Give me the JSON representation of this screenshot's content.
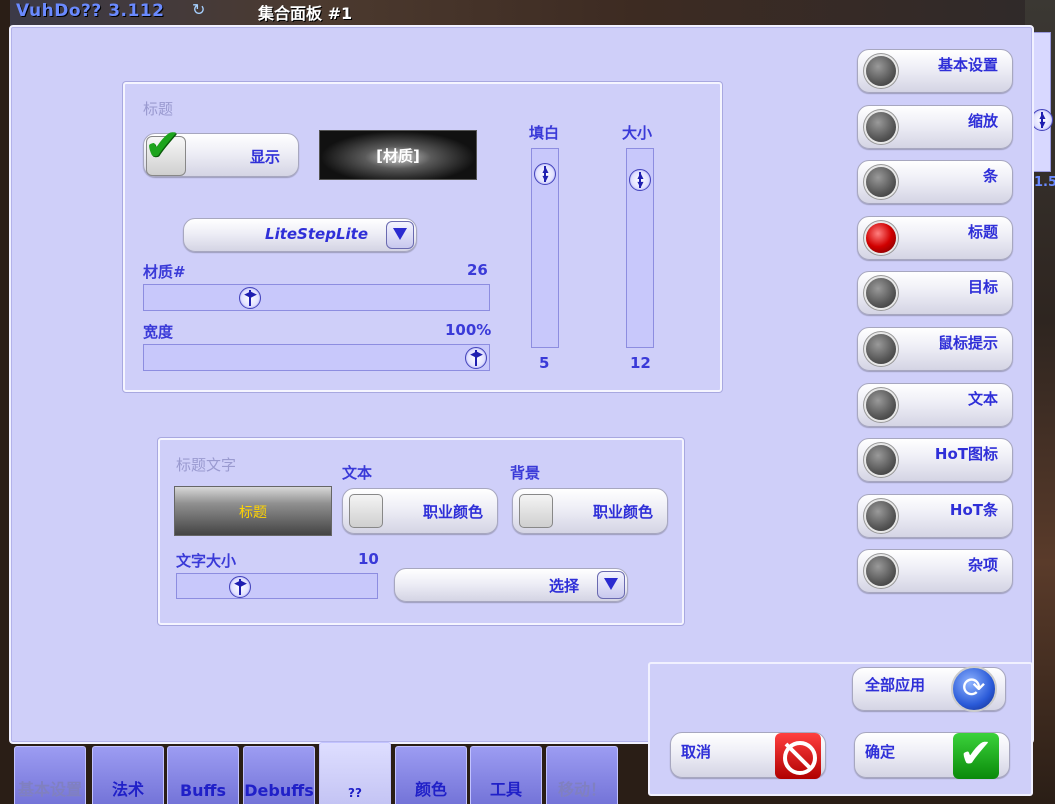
{
  "topbar": {
    "title": "VuhDo?? 3.112",
    "refresh_icon": "refresh-icon",
    "tab_label": "集合面板 #1"
  },
  "title_panel": {
    "heading": "标题",
    "show_label": "显示",
    "show_checked": true,
    "texture_label": "[材质]",
    "texture_select": "LiteStepLite",
    "texture_num_label": "材质#",
    "texture_num_value": "26",
    "width_label": "宽度",
    "width_value": "100%",
    "padding_label": "填白",
    "padding_value": "5",
    "size_label": "大小",
    "size_value": "12"
  },
  "title_text_panel": {
    "heading": "标题文字",
    "preview": "标题",
    "text_label": "文本",
    "text_color_button": "职业颜色",
    "bg_label": "背景",
    "bg_color_button": "职业颜色",
    "font_size_label": "文字大小",
    "font_size_value": "10",
    "select_button": "选择"
  },
  "side_menu": [
    {
      "label": "基本设置",
      "active": false
    },
    {
      "label": "缩放",
      "active": false
    },
    {
      "label": "条",
      "active": false
    },
    {
      "label": "标题",
      "active": true
    },
    {
      "label": "目标",
      "active": false
    },
    {
      "label": "鼠标提示",
      "active": false
    },
    {
      "label": "文本",
      "active": false
    },
    {
      "label": "HoT图标",
      "active": false
    },
    {
      "label": "HoT条",
      "active": false
    },
    {
      "label": "杂项",
      "active": false
    }
  ],
  "actions": {
    "apply_all": "全部应用",
    "cancel": "取消",
    "ok": "确定"
  },
  "bottom_tabs": [
    {
      "label": "基本设置",
      "active": false,
      "disabled": true
    },
    {
      "label": "法术",
      "active": false,
      "disabled": false
    },
    {
      "label": "Buffs",
      "active": false,
      "disabled": false
    },
    {
      "label": "Debuffs",
      "active": false,
      "disabled": false
    },
    {
      "label": "??",
      "active": true,
      "disabled": false
    },
    {
      "label": "颜色",
      "active": false,
      "disabled": false
    },
    {
      "label": "工具",
      "active": false,
      "disabled": false
    },
    {
      "label": "移动！",
      "active": false,
      "disabled": true
    }
  ],
  "scroll_value": "1.5"
}
